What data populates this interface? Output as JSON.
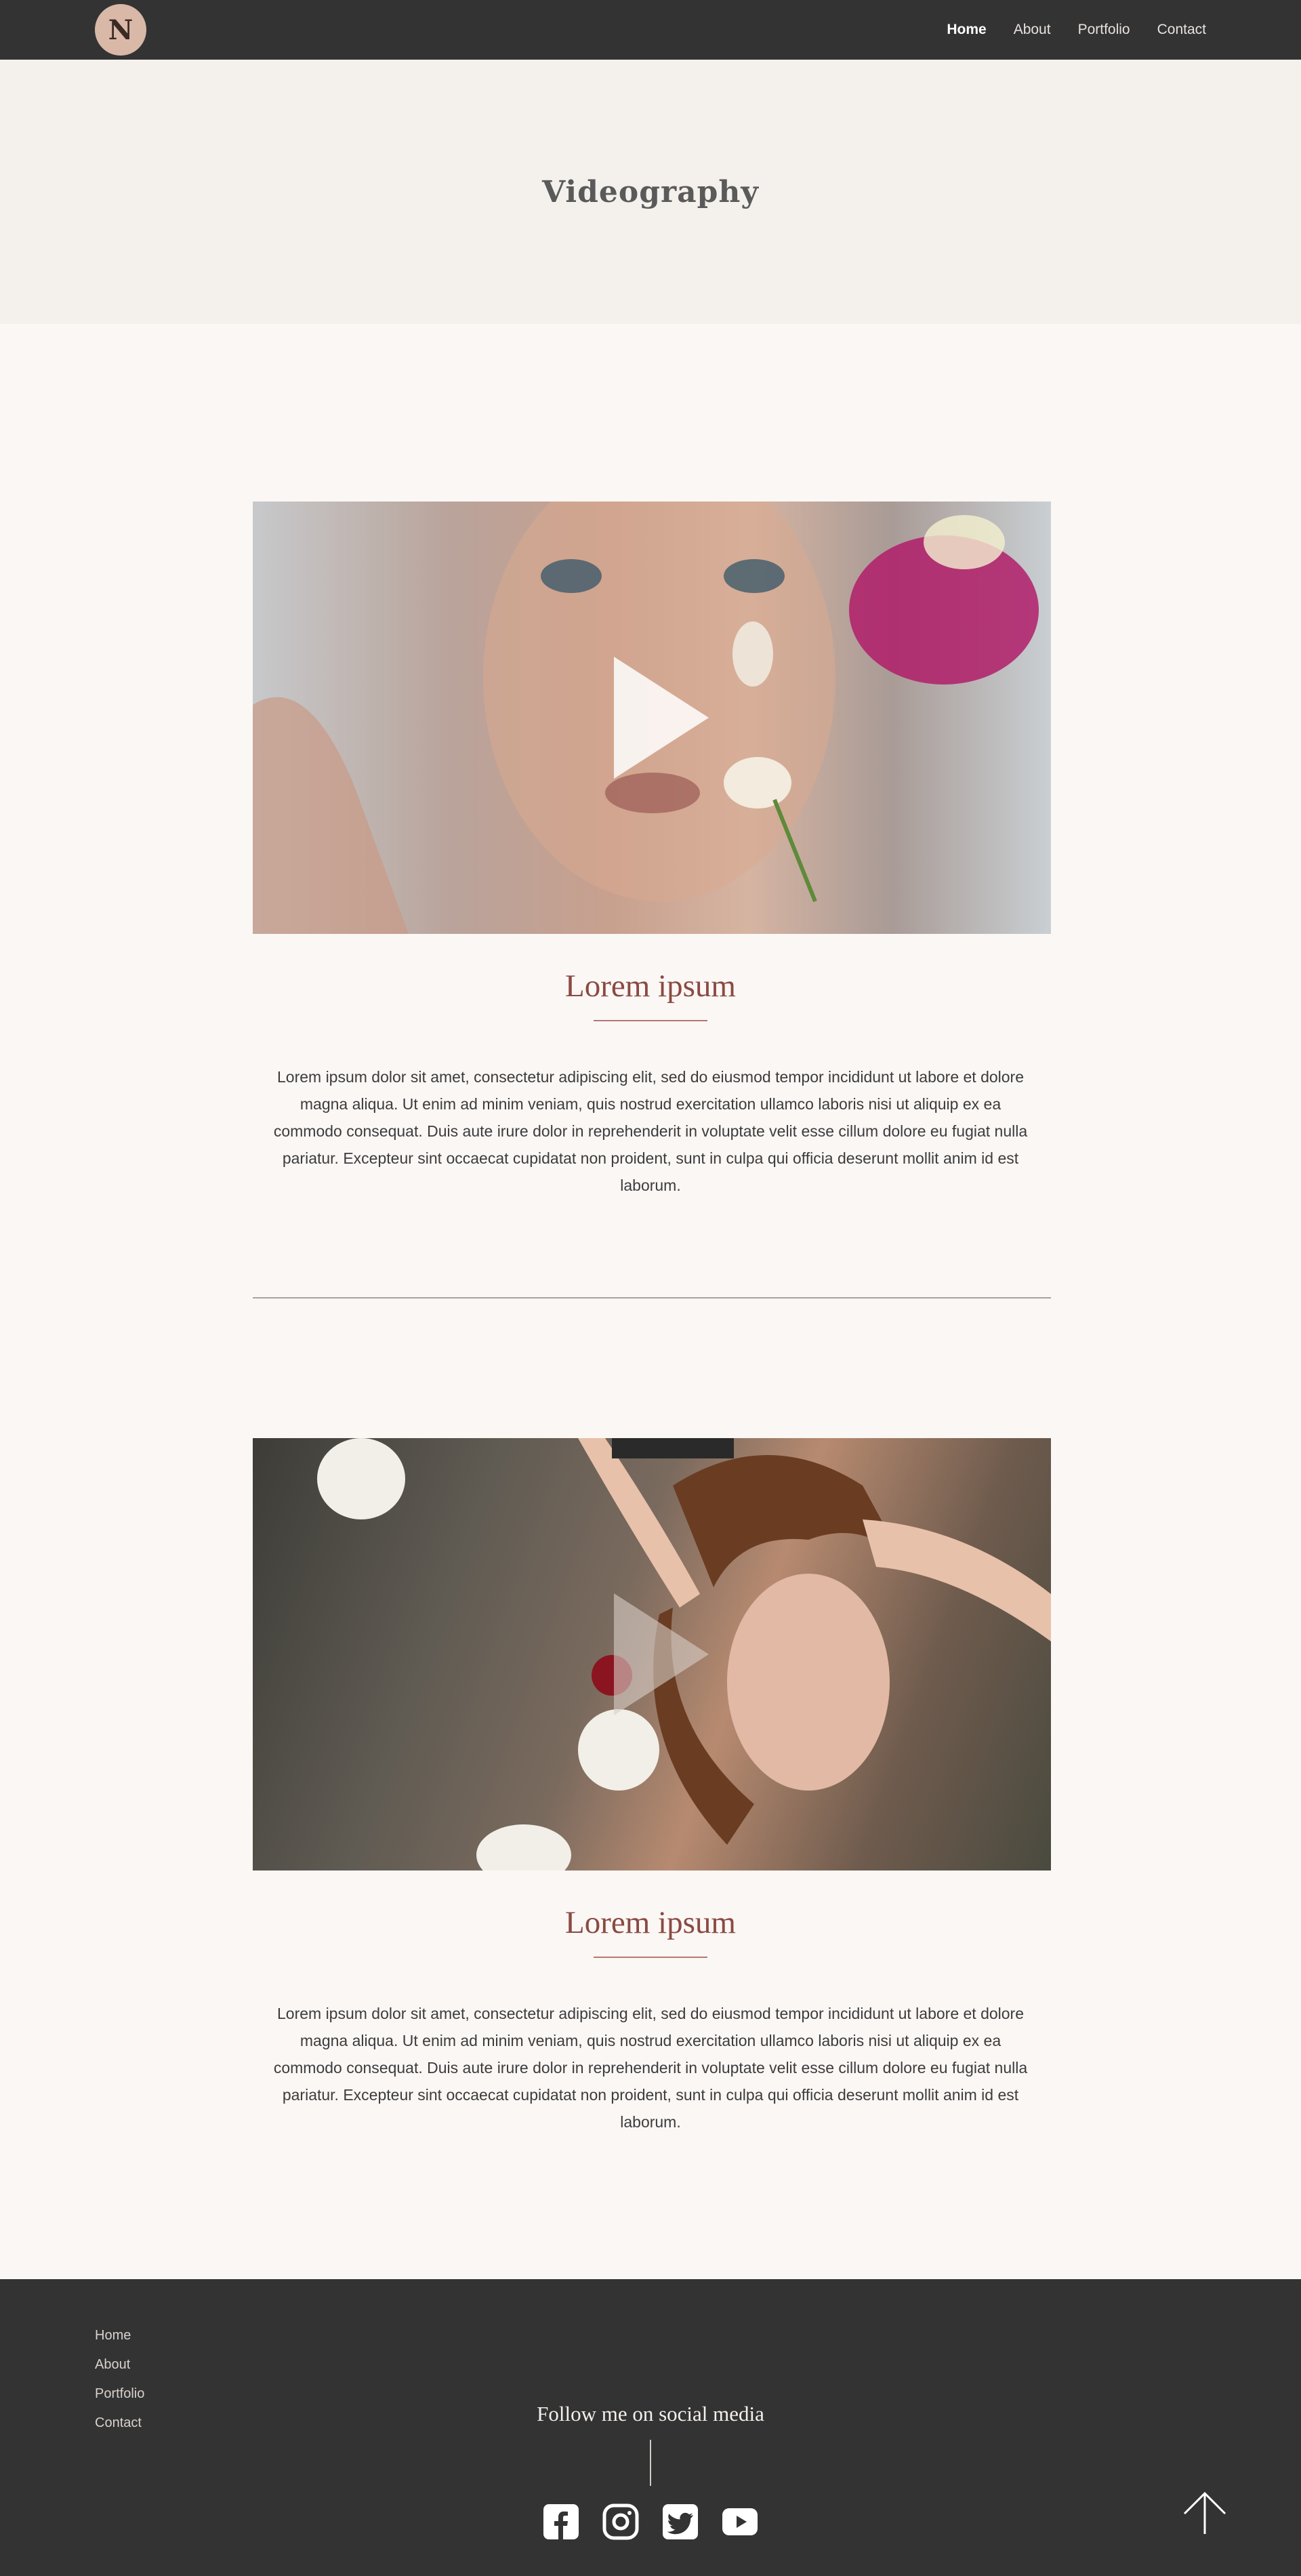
{
  "header": {
    "logo_letter": "N",
    "nav": [
      {
        "label": "Home",
        "active": true
      },
      {
        "label": "About",
        "active": false
      },
      {
        "label": "Portfolio",
        "active": false
      },
      {
        "label": "Contact",
        "active": false
      }
    ]
  },
  "hero": {
    "title": "Videography"
  },
  "projects": [
    {
      "title": "Lorem ipsum",
      "body": "Lorem ipsum dolor sit amet, consectetur adipiscing elit, sed do eiusmod tempor incididunt ut labore et dolore magna aliqua. Ut enim ad minim veniam, quis nostrud exercitation ullamco laboris nisi ut aliquip ex ea commodo consequat. Duis aute irure dolor in reprehenderit in voluptate velit esse cillum dolore eu fugiat nulla pariatur. Excepteur sint occaecat cupidatat non proident, sunt in culpa qui officia deserunt mollit anim id est laborum."
    },
    {
      "title": "Lorem ipsum",
      "body": "Lorem ipsum dolor sit amet, consectetur adipiscing elit, sed do eiusmod tempor incididunt ut labore et dolore magna aliqua. Ut enim ad minim veniam, quis nostrud exercitation ullamco laboris nisi ut aliquip ex ea commodo consequat. Duis aute irure dolor in reprehenderit in voluptate velit esse cillum dolore eu fugiat nulla pariatur. Excepteur sint occaecat cupidatat non proident, sunt in culpa qui officia deserunt mollit anim id est laborum."
    }
  ],
  "footer": {
    "nav": [
      "Home",
      "About",
      "Portfolio",
      "Contact"
    ],
    "follow_text": "Follow me on social media",
    "social_icons": [
      "facebook-icon",
      "instagram-icon",
      "twitter-icon",
      "youtube-icon"
    ],
    "back_to_top_icon": "arrow-up-icon"
  },
  "colors": {
    "header_bg": "#333333",
    "hero_bg": "#f4f0ec",
    "page_bg": "#fbf7f5",
    "accent_title": "#8a4a42"
  }
}
